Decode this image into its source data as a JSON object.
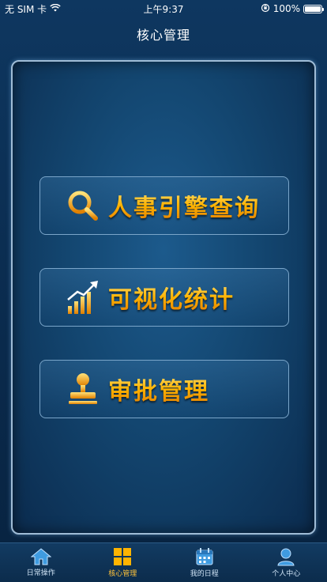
{
  "status_bar": {
    "carrier": "无 SIM 卡",
    "time": "上午9:37",
    "battery": "100%"
  },
  "nav": {
    "title": "核心管理"
  },
  "menu": [
    {
      "label": "人事引擎查询",
      "icon": "search-icon"
    },
    {
      "label": "可视化统计",
      "icon": "bar-chart-icon"
    },
    {
      "label": "审批管理",
      "icon": "stamp-icon"
    }
  ],
  "tabs": [
    {
      "label": "日常操作",
      "icon": "home-icon",
      "active": false
    },
    {
      "label": "核心管理",
      "icon": "grid-icon",
      "active": true
    },
    {
      "label": "我的日程",
      "icon": "calendar-icon",
      "active": false
    },
    {
      "label": "个人中心",
      "icon": "user-icon",
      "active": false
    }
  ],
  "colors": {
    "accent": "#ffb400",
    "tab_active": "#ffc23a",
    "background": "#0b2a48"
  }
}
